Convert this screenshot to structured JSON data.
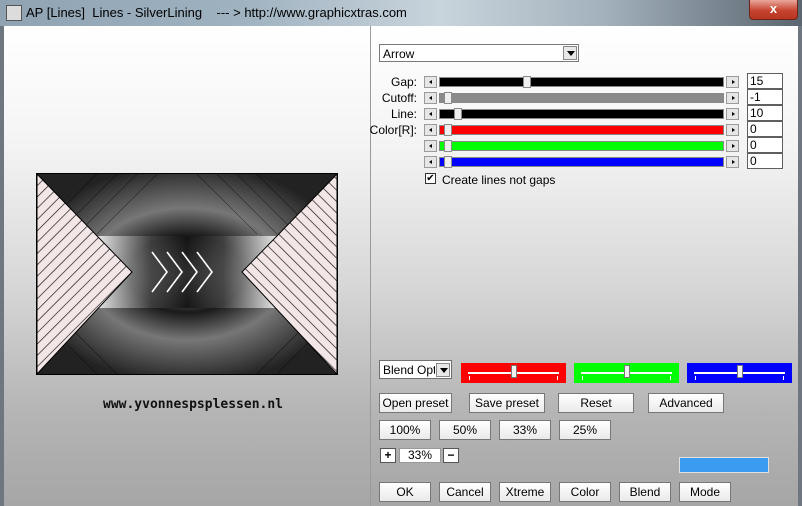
{
  "window": {
    "title": "AP [Lines]  Lines - SilverLining    --- > http://www.graphicxtras.com",
    "close_label": "x"
  },
  "preview": {
    "watermark": "www.yvonnespsplessen.nl"
  },
  "preset_select": {
    "value": "Arrow"
  },
  "sliders": [
    {
      "label": "Gap:",
      "value": "15",
      "fraction": 0.3,
      "color": "#000000"
    },
    {
      "label": "Cutoff:",
      "value": "-1",
      "fraction": 0.0,
      "color": "#8a8a8a"
    },
    {
      "label": "Line:",
      "value": "10",
      "fraction": 0.05,
      "color": "#000000"
    },
    {
      "label": "Color[R]:",
      "value": "0",
      "fraction": 0.0,
      "color": "#ff0000"
    },
    {
      "label": "",
      "value": "0",
      "fraction": 0.0,
      "color": "#00ff00"
    },
    {
      "label": "",
      "value": "0",
      "fraction": 0.0,
      "color": "#0000ff"
    }
  ],
  "checkbox": {
    "label": "Create lines not gaps",
    "checked": true,
    "mark": "✔"
  },
  "blend_select": {
    "value": "Blend Options"
  },
  "channel_sliders": [
    {
      "color": "#ff0000",
      "fraction": 0.5
    },
    {
      "color": "#00ff00",
      "fraction": 0.5
    },
    {
      "color": "#0000ff",
      "fraction": 0.5
    }
  ],
  "buttons": {
    "open_preset": "Open preset",
    "save_preset": "Save preset",
    "reset": "Reset",
    "advanced": "Advanced",
    "zoom_100": "100%",
    "zoom_50": "50%",
    "zoom_33": "33%",
    "zoom_25": "25%",
    "ok": "OK",
    "cancel": "Cancel",
    "xtreme": "Xtreme",
    "color": "Color",
    "blend": "Blend",
    "mode": "Mode"
  },
  "zoom": {
    "plus": "+",
    "minus": "−",
    "value": "33%"
  },
  "color_swatch": "#3a9bf0"
}
